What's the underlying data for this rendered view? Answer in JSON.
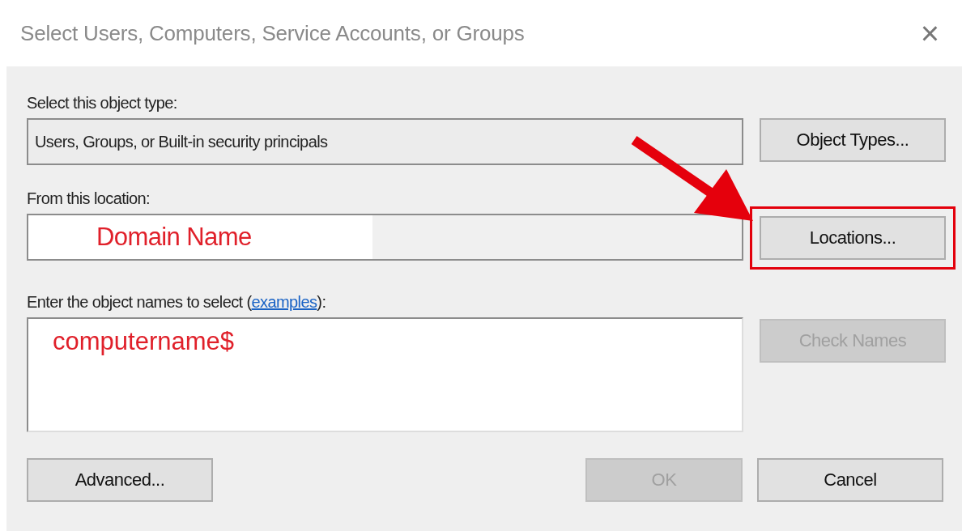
{
  "window": {
    "title": "Select Users, Computers, Service Accounts, or Groups",
    "close": "×"
  },
  "object_type": {
    "label": "Select this object type:",
    "value": "Users, Groups, or Built-in security principals",
    "button": {
      "label": "Object Types...",
      "disabled": false,
      "highlighted": false
    }
  },
  "location": {
    "label": "From this location:",
    "value": "Domain Name",
    "button": {
      "label": "Locations...",
      "disabled": false,
      "highlighted": true
    }
  },
  "names": {
    "label_before": "Enter the object names to select (",
    "link": "examples",
    "label_after": "):",
    "value": "computername$",
    "button": {
      "label": "Check Names",
      "disabled": true,
      "highlighted": false
    }
  },
  "footer": [
    {
      "label": "Advanced...",
      "disabled": false
    },
    {
      "label": "OK",
      "disabled": true
    },
    {
      "label": "Cancel",
      "disabled": false
    }
  ]
}
